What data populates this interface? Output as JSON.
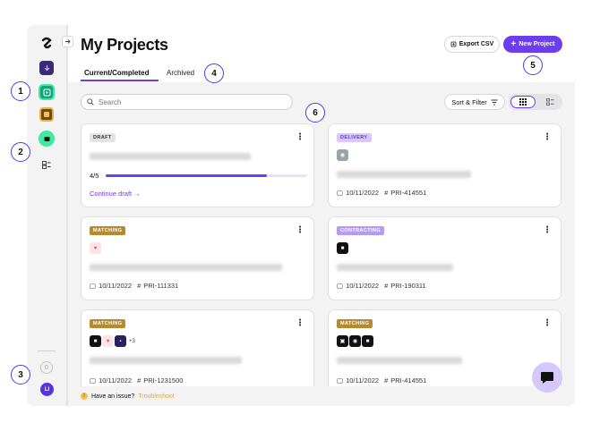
{
  "header": {
    "title": "My Projects",
    "export_label": "Export CSV",
    "new_project_label": "New Project"
  },
  "tabs": [
    {
      "label": "Current/Completed",
      "active": true
    },
    {
      "label": "Archived",
      "active": false
    }
  ],
  "toolbar": {
    "search_placeholder": "Search",
    "sort_label": "Sort & Filter",
    "view_mode": "grid"
  },
  "sidebar": {
    "notification_count": "0",
    "avatar_initials": "LI",
    "icons": [
      "logo",
      "app-1",
      "app-2",
      "app-3",
      "app-4",
      "list-icon"
    ]
  },
  "cards": [
    {
      "status": "DRAFT",
      "progress_text": "4/5",
      "progress": 0.8,
      "link": "Continue draft →"
    },
    {
      "status": "DELIVERY",
      "date": "10/11/2022",
      "id": "PRI-414551"
    },
    {
      "status": "MATCHING",
      "date": "10/11/2022",
      "id": "PRI-111331"
    },
    {
      "status": "CONTRACTING",
      "date": "10/11/2022",
      "id": "PRI-190311"
    },
    {
      "status": "MATCHING",
      "more": "+3",
      "date": "10/11/2022",
      "id": "PRI-1231500"
    },
    {
      "status": "MATCHING",
      "date": "10/11/2022",
      "id": "PRI-414551"
    }
  ],
  "footer": {
    "text": "Have an issue?",
    "link": "Troubleshoot"
  },
  "callouts": [
    "1",
    "2",
    "3",
    "4",
    "5",
    "6"
  ],
  "colors": {
    "accent": "#6d3df2",
    "green": "#3ee9a2",
    "matching": "#b88a2e",
    "contracting": "#b69af7"
  }
}
